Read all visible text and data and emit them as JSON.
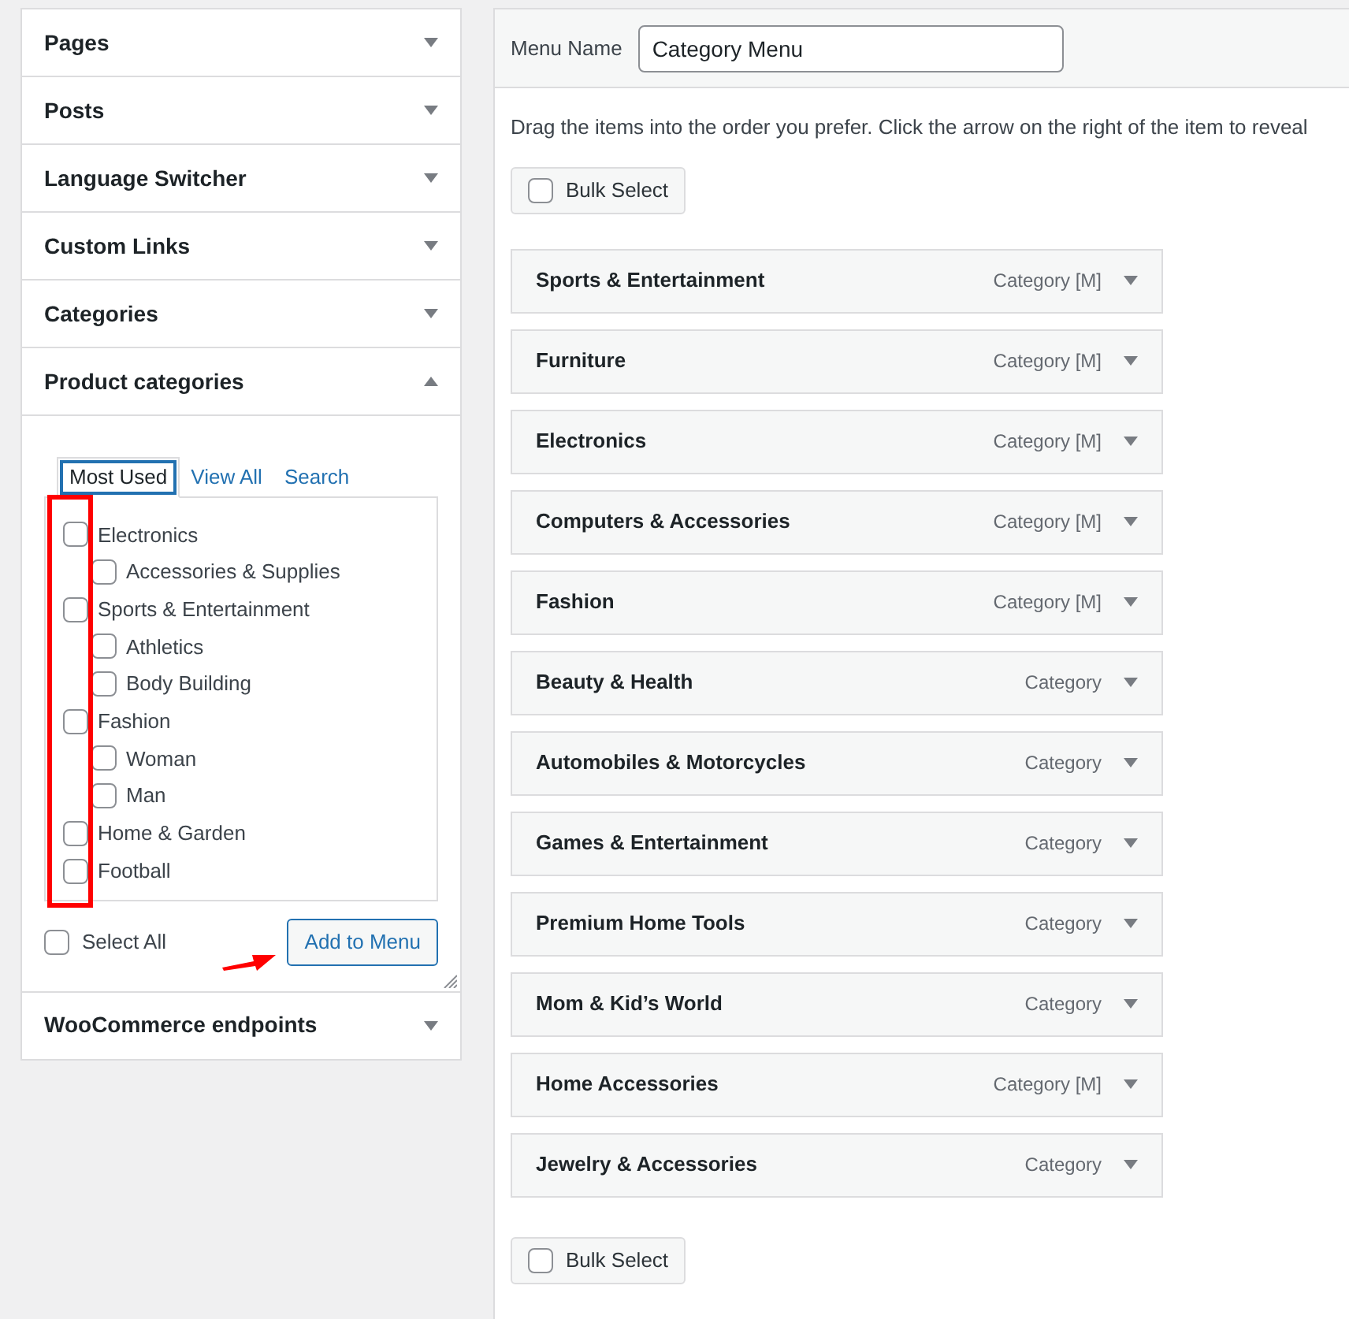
{
  "sections": [
    {
      "title": "Pages",
      "expanded": false
    },
    {
      "title": "Posts",
      "expanded": false
    },
    {
      "title": "Language Switcher",
      "expanded": false
    },
    {
      "title": "Custom Links",
      "expanded": false
    },
    {
      "title": "Categories",
      "expanded": false
    },
    {
      "title": "Product categories",
      "expanded": true
    },
    {
      "title": "WooCommerce endpoints",
      "expanded": false
    }
  ],
  "category_tabs": [
    {
      "label": "Most Used",
      "selected": true
    },
    {
      "label": "View All",
      "selected": false
    },
    {
      "label": "Search",
      "selected": false
    }
  ],
  "category_list": [
    {
      "label": "Electronics",
      "checked": false,
      "children": [
        {
          "label": "Accessories & Supplies",
          "checked": false
        }
      ]
    },
    {
      "label": "Sports & Entertainment",
      "checked": false,
      "children": [
        {
          "label": "Athletics",
          "checked": false
        },
        {
          "label": "Body Building",
          "checked": false
        }
      ]
    },
    {
      "label": "Fashion",
      "checked": false,
      "children": [
        {
          "label": "Woman",
          "checked": false
        },
        {
          "label": "Man",
          "checked": false
        }
      ]
    },
    {
      "label": "Home & Garden",
      "checked": false
    },
    {
      "label": "Football",
      "checked": false
    }
  ],
  "select_all": {
    "label": "Select All",
    "checked": false
  },
  "add_button": "Add to Menu",
  "menu_name": {
    "label": "Menu Name",
    "value": "Category Menu"
  },
  "instructions": "Drag the items into the order you prefer. Click the arrow on the right of the item to reveal",
  "bulk_select_top": {
    "label": "Bulk Select",
    "checked": false
  },
  "menu_items": [
    {
      "title": "Sports & Entertainment",
      "type": "Category [M]"
    },
    {
      "title": "Furniture",
      "type": "Category [M]"
    },
    {
      "title": "Electronics",
      "type": "Category [M]"
    },
    {
      "title": "Computers & Accessories",
      "type": "Category [M]"
    },
    {
      "title": "Fashion",
      "type": "Category [M]"
    },
    {
      "title": "Beauty & Health",
      "type": "Category"
    },
    {
      "title": "Automobiles & Motorcycles",
      "type": "Category"
    },
    {
      "title": "Games & Entertainment",
      "type": "Category"
    },
    {
      "title": "Premium Home Tools",
      "type": "Category"
    },
    {
      "title": "Mom & Kid’s World",
      "type": "Category"
    },
    {
      "title": "Home Accessories",
      "type": "Category [M]"
    },
    {
      "title": "Jewelry & Accessories",
      "type": "Category"
    }
  ],
  "bulk_select_bottom": {
    "label": "Bulk Select",
    "checked": false
  }
}
